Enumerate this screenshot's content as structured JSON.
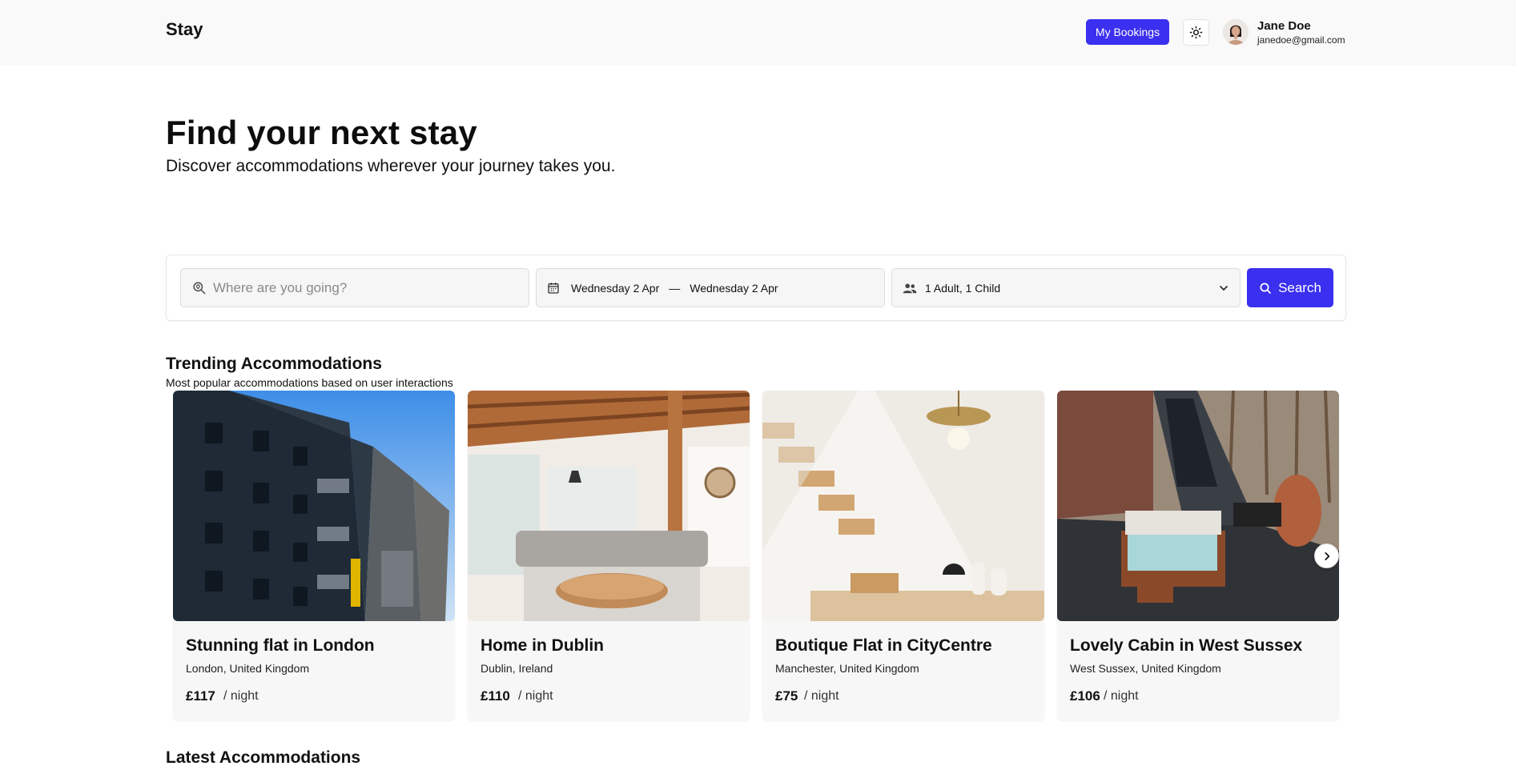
{
  "header": {
    "logo": "Stay",
    "my_bookings_label": "My Bookings",
    "theme_toggle_icon": "sun-icon",
    "user": {
      "name": "Jane Doe",
      "email": "janedoe@gmail.com"
    }
  },
  "hero": {
    "title": "Find your next stay",
    "subtitle": "Discover accommodations wherever your journey takes you."
  },
  "search": {
    "where_placeholder": "Where are you going?",
    "where_value": "",
    "check_in": "Wednesday 2 Apr",
    "date_separator": "—",
    "check_out": "Wednesday 2 Apr",
    "guests": "1 Adult, 1 Child",
    "search_label": "Search",
    "accent_color": "#3b2ff0"
  },
  "trending": {
    "title": "Trending Accommodations",
    "subtitle": "Most popular accommodations based on user interactions",
    "cards": [
      {
        "title": "Stunning flat in London",
        "location": "London, United Kingdom",
        "price": "£117",
        "per": "/ night"
      },
      {
        "title": "Home in Dublin",
        "location": "Dublin, Ireland",
        "price": "£110",
        "per": "/ night"
      },
      {
        "title": "Boutique Flat in CityCentre",
        "location": "Manchester, United Kingdom",
        "price": "£75",
        "per": "/ night"
      },
      {
        "title": "Lovely Cabin in West Sussex",
        "location": "West Sussex, United Kingdom",
        "price": "£106",
        "per": "/ night"
      }
    ]
  },
  "latest": {
    "title": "Latest Accommodations"
  }
}
